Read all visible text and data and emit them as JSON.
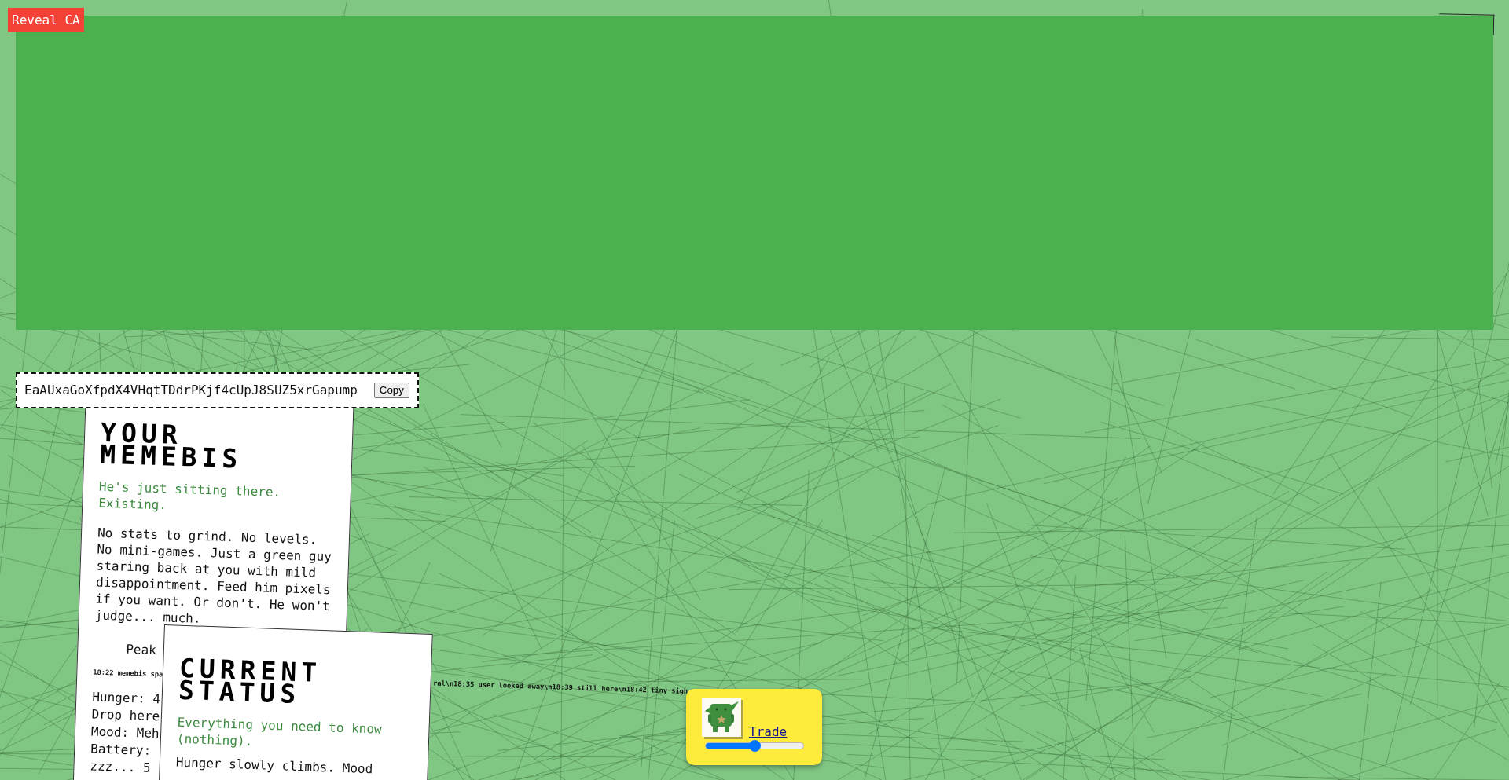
{
  "reveal_button": {
    "label": "Reveal CA"
  },
  "contract": {
    "address": "EaAUxaGoXfpdX4VHqtTDdrPKjf4cUpJ8SUZ5xrGapump",
    "copy_button": "Copy"
  },
  "cards": [
    {
      "title": "YOUR MEMEBIS",
      "subtitle": "He's just sitting there. Existing.",
      "description": "No stats to grind. No levels. No mini-games. Just a green guy staring back at you with mild disappointment. Feed him pixels if you want. Or don't. He won't judge... much.",
      "lines": [
        {
          "kind": "caption",
          "text": "Peak"
        },
        {
          "kind": "log",
          "segments": [
            "18:22 memebis spa",
            "ral\\n18:35 user looked away\\n18:39 still here\\n18:42 tiny sigh"
          ]
        },
        {
          "kind": "stat",
          "text": "Hunger: 4"
        },
        {
          "kind": "stat",
          "text": "Drop here"
        },
        {
          "kind": "stat",
          "text": "Mood: Meh"
        },
        {
          "kind": "stat",
          "text": "Battery:"
        },
        {
          "kind": "stat",
          "text": "zzz... 5"
        }
      ]
    },
    {
      "title": "CURRENT STATUS",
      "subtitle": "Everything you need to know (nothing).",
      "description": "Hunger slowly climbs. Mood"
    }
  ],
  "trade": {
    "link": "Trade",
    "slider": {
      "level": 0.5
    }
  }
}
